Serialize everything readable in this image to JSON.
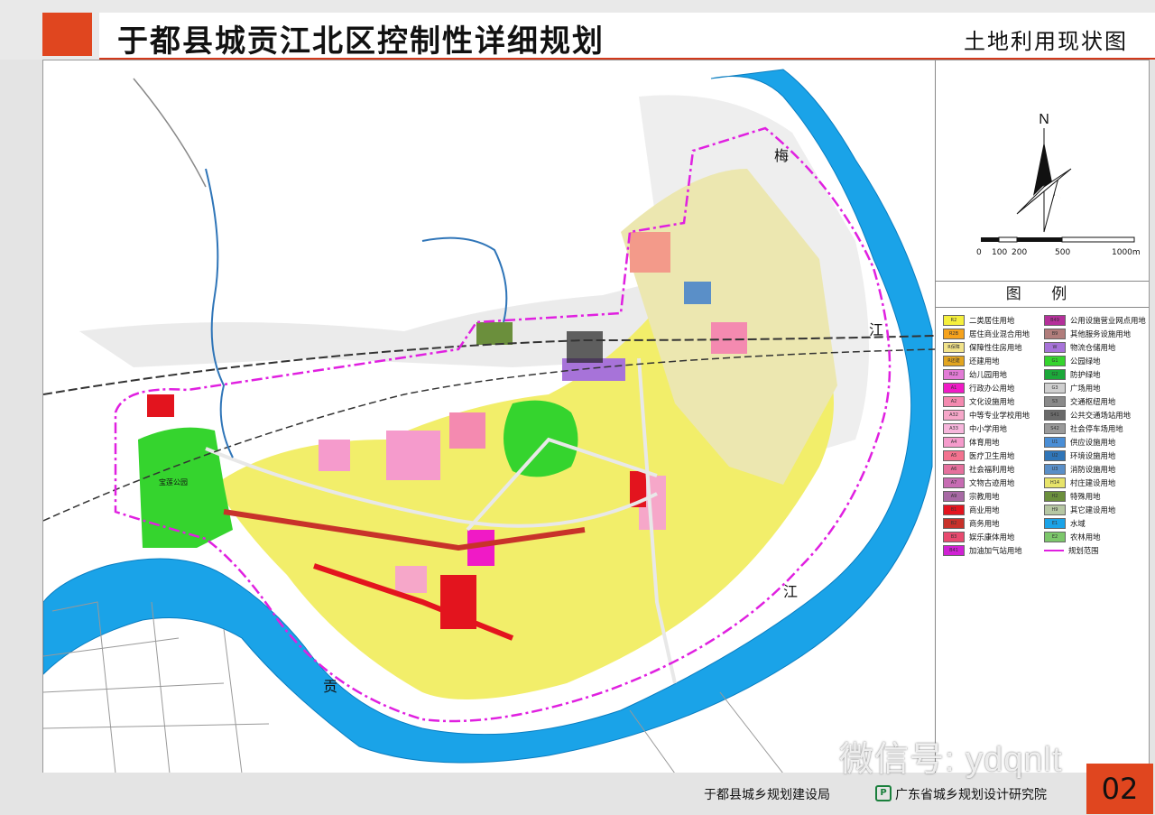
{
  "header": {
    "title": "于都县城贡江北区控制性详细规划",
    "subtitle": "土地利用现状图"
  },
  "map": {
    "river_labels": [
      "梅",
      "江",
      "江",
      "贡"
    ],
    "place_labels": [
      "宝莲公园"
    ],
    "scale_labels": [
      "0",
      "100",
      "200",
      "500",
      "1000m"
    ],
    "north_label": "N"
  },
  "legend": {
    "title": "图 例",
    "left": [
      {
        "code": "R2",
        "label": "二类居住用地",
        "color": "#f5ef3d"
      },
      {
        "code": "R2B",
        "label": "居住商业混合用地",
        "color": "#f6a21c"
      },
      {
        "code": "R保障",
        "label": "保障性住房用地",
        "color": "#f2e38a"
      },
      {
        "code": "R还建",
        "label": "还建用地",
        "color": "#e2a520"
      },
      {
        "code": "R22",
        "label": "幼儿园用地",
        "color": "#e27bd6"
      },
      {
        "code": "A1",
        "label": "行政办公用地",
        "color": "#f01ac6"
      },
      {
        "code": "A2",
        "label": "文化设施用地",
        "color": "#f48ab0"
      },
      {
        "code": "A32",
        "label": "中等专业学校用地",
        "color": "#f6a7c9"
      },
      {
        "code": "A33",
        "label": "中小学用地",
        "color": "#f7b6dc"
      },
      {
        "code": "A4",
        "label": "体育用地",
        "color": "#f59bcc"
      },
      {
        "code": "A5",
        "label": "医疗卫生用地",
        "color": "#f3728f"
      },
      {
        "code": "A6",
        "label": "社会福利用地",
        "color": "#e5709d"
      },
      {
        "code": "A7",
        "label": "文物古迹用地",
        "color": "#c76cb3"
      },
      {
        "code": "A9",
        "label": "宗教用地",
        "color": "#a86aa5"
      },
      {
        "code": "B1",
        "label": "商业用地",
        "color": "#e3141e"
      },
      {
        "code": "B2",
        "label": "商务用地",
        "color": "#c8322a"
      },
      {
        "code": "B3",
        "label": "娱乐康体用地",
        "color": "#e84a6f"
      },
      {
        "code": "B41",
        "label": "加油加气站用地",
        "color": "#d021d4"
      }
    ],
    "right": [
      {
        "code": "B49",
        "label": "公用设施营业网点用地",
        "color": "#b4309a"
      },
      {
        "code": "B9",
        "label": "其他服务设施用地",
        "color": "#b17d7b"
      },
      {
        "code": "W",
        "label": "物流仓储用地",
        "color": "#a773d9"
      },
      {
        "code": "G1",
        "label": "公园绿地",
        "color": "#35d42e"
      },
      {
        "code": "G2",
        "label": "防护绿地",
        "color": "#1ca83a"
      },
      {
        "code": "G3",
        "label": "广场用地",
        "color": "#cfcfcf"
      },
      {
        "code": "S3",
        "label": "交通枢纽用地",
        "color": "#8a8a8a"
      },
      {
        "code": "S41",
        "label": "公共交通场站用地",
        "color": "#6a6a6a"
      },
      {
        "code": "S42",
        "label": "社会停车场用地",
        "color": "#9a9a9a"
      },
      {
        "code": "U1",
        "label": "供应设施用地",
        "color": "#4a8ed6"
      },
      {
        "code": "U2",
        "label": "环境设施用地",
        "color": "#2f75b8"
      },
      {
        "code": "U3",
        "label": "消防设施用地",
        "color": "#5a8fc8"
      },
      {
        "code": "H14",
        "label": "村庄建设用地",
        "color": "#e8e46a"
      },
      {
        "code": "H2",
        "label": "特殊用地",
        "color": "#6b8f3c"
      },
      {
        "code": "H9",
        "label": "其它建设用地",
        "color": "#b6c7a3"
      },
      {
        "code": "E1",
        "label": "水域",
        "color": "#1aa3e8"
      },
      {
        "code": "E2",
        "label": "农林用地",
        "color": "#7cc76b"
      },
      {
        "code": "",
        "label": "规划范围",
        "color": "#ffffff"
      }
    ]
  },
  "footer": {
    "org1": "于都县城乡规划建设局",
    "org2": "广东省城乡规划设计研究院",
    "page_number": "02",
    "watermark": "微信号: ydqnlt",
    "logo_glyph": "P"
  }
}
